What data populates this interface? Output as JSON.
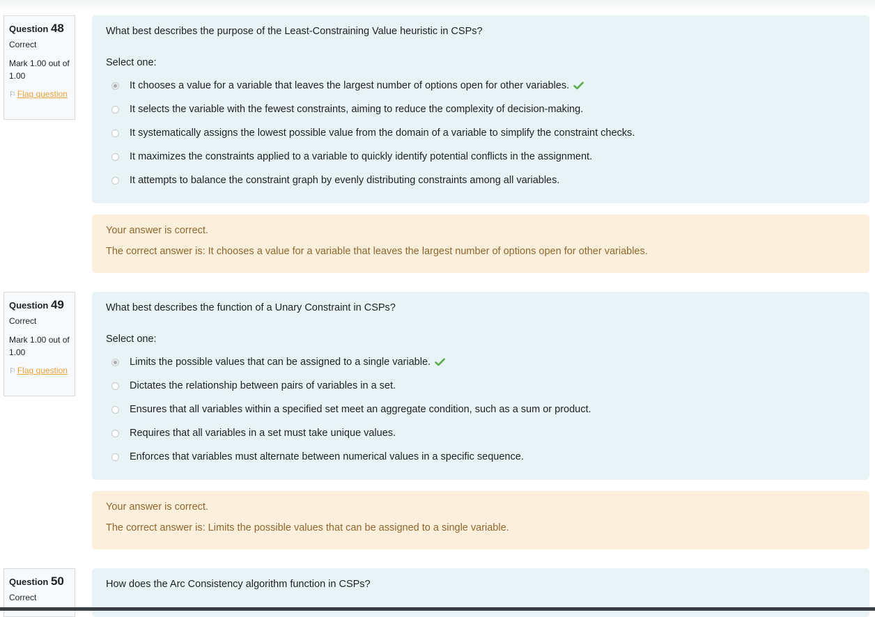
{
  "questions": [
    {
      "label": "Question",
      "number": "48",
      "state": "Correct",
      "grade": "Mark 1.00 out of 1.00",
      "flag_label": "Flag question",
      "text": "What best describes the purpose of the Least-Constraining Value heuristic in CSPs?",
      "prompt": "Select one:",
      "options": [
        "It chooses a value for a variable that leaves the largest number of options open for other variables.",
        "It selects the variable with the fewest constraints, aiming to reduce the complexity of decision-making.",
        "It systematically assigns the lowest possible value from the domain of a variable to simplify the constraint checks.",
        "It maximizes the constraints applied to a variable to quickly identify potential conflicts in the assignment.",
        "It attempts to balance the constraint graph by evenly distributing constraints among all variables."
      ],
      "selected_index": 0,
      "feedback_status": "Your answer is correct.",
      "feedback_answer": "The correct answer is: It chooses a value for a variable that leaves the largest number of options open for other variables."
    },
    {
      "label": "Question",
      "number": "49",
      "state": "Correct",
      "grade": "Mark 1.00 out of 1.00",
      "flag_label": "Flag question",
      "text": "What best describes the function of a Unary Constraint in CSPs?",
      "prompt": "Select one:",
      "options": [
        "Limits the possible values that can be assigned to a single variable.",
        "Dictates the relationship between pairs of variables in a set.",
        "Ensures that all variables within a specified set meet an aggregate condition, such as a sum or product.",
        "Requires that all variables in a set must take unique values.",
        "Enforces that variables must alternate between numerical values in a specific sequence."
      ],
      "selected_index": 0,
      "feedback_status": "Your answer is correct.",
      "feedback_answer": "The correct answer is: Limits the possible values that can be assigned to a single variable."
    },
    {
      "label": "Question",
      "number": "50",
      "state": "Correct",
      "text": "How does the Arc Consistency algorithm function in CSPs?"
    }
  ],
  "colors": {
    "formulation_bg": "#e7f3f5",
    "feedback_bg": "#fcefdc",
    "feedback_text": "#8e662e",
    "flag_link": "#e8a23c",
    "tick": "#5cab4e"
  },
  "icons": {
    "flag": "flag-icon",
    "correct": "check-icon"
  }
}
